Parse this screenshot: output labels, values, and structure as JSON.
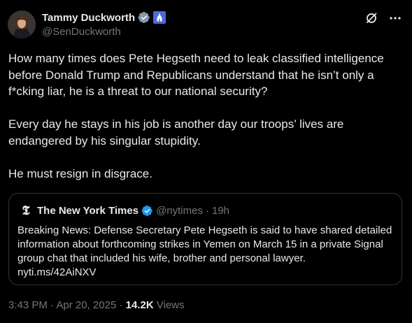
{
  "author": {
    "display_name": "Tammy Duckworth",
    "handle": "@SenDuckworth"
  },
  "actions": {
    "grok_icon": "grok-slash-icon",
    "more_icon": "more-dots-icon"
  },
  "tweet": {
    "paragraphs": [
      "How many times does Pete Hegseth need to leak classified intelligence before Donald Trump and Republicans understand that he isn’t only a f*cking liar, he is a threat to our national security?",
      "Every day he stays in his job is another day our troops’ lives are endangered by his singular stupidity.",
      "He must resign in disgrace."
    ]
  },
  "quoted": {
    "name": "The New York Times",
    "handle": "@nytimes",
    "separator": "·",
    "time": "19h",
    "text": "Breaking News: Defense Secretary Pete Hegseth is said to have shared detailed information about forthcoming strikes in Yemen on March 15 in a private Signal group chat that included his wife, brother and personal lawyer.",
    "link": "nyti.ms/42AiNXV"
  },
  "meta": {
    "time": "3:43 PM",
    "separator": "·",
    "date": "Apr 20, 2025",
    "views_count": "14.2K",
    "views_label": "Views"
  },
  "colors": {
    "background": "#000000",
    "text": "#e7e9ea",
    "secondary": "#71767b",
    "verified_blue": "#1d9bf0",
    "gov_badge": "#829aab",
    "border": "#2f3336"
  }
}
